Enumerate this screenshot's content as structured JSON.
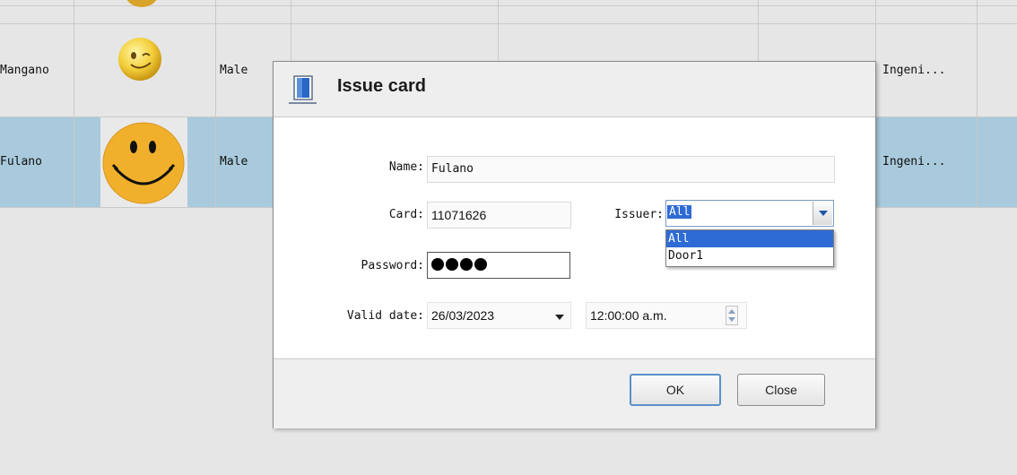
{
  "background_table": {
    "rows": [
      {
        "name": "Mangano",
        "gender": "Male",
        "job": "Ingeni...",
        "avatar": "wink-smiley-icon"
      },
      {
        "name": "Fulano",
        "gender": "Male",
        "job": "Ingeni...",
        "avatar": "smile-smiley-icon",
        "selected": true
      }
    ],
    "selected_row_color": "#a9cadc"
  },
  "dialog": {
    "title": "Issue card",
    "icon": "door-icon",
    "form": {
      "name_label": "Name:",
      "name_value": "Fulano",
      "card_label": "Card:",
      "card_value": "11071626",
      "issuer_label": "Issuer:",
      "issuer_value": "All",
      "issuer_options": [
        "All",
        "Door1"
      ],
      "password_label": "Password:",
      "password_dots": 4,
      "valid_date_label": "Valid date:",
      "valid_date_value": "26/03/2023",
      "valid_time_value": "12:00:00 a.m."
    },
    "buttons": {
      "ok_label": "OK",
      "close_label": "Close"
    },
    "accent_color": "#2f6bd5"
  }
}
